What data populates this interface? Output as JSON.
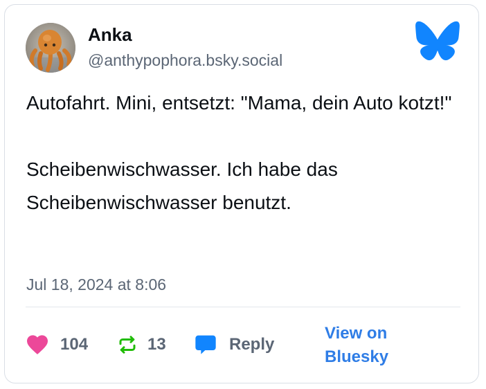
{
  "author": {
    "name": "Anka",
    "handle": "@anthypophora.bsky.social",
    "avatar_icon": "octopus-plush-avatar"
  },
  "brand": {
    "logo_icon": "bluesky-butterfly-icon",
    "accent_color": "#1185fe"
  },
  "post": {
    "paragraphs": [
      "Autofahrt. Mini, entsetzt: \"Mama, dein Auto kotzt!\"",
      "Scheibenwischwasser. Ich habe das Scheibenwischwasser benutzt."
    ],
    "timestamp": "Jul 18, 2024 at 8:06"
  },
  "actions": {
    "like": {
      "icon": "heart-icon",
      "count": "104",
      "color": "#ec4899"
    },
    "repost": {
      "icon": "repost-icon",
      "count": "13",
      "color": "#20bc07"
    },
    "reply": {
      "icon": "reply-bubble-icon",
      "label": "Reply",
      "color": "#1185fe"
    },
    "view_link": {
      "label": "View on Bluesky",
      "color": "#2f7de6"
    }
  }
}
